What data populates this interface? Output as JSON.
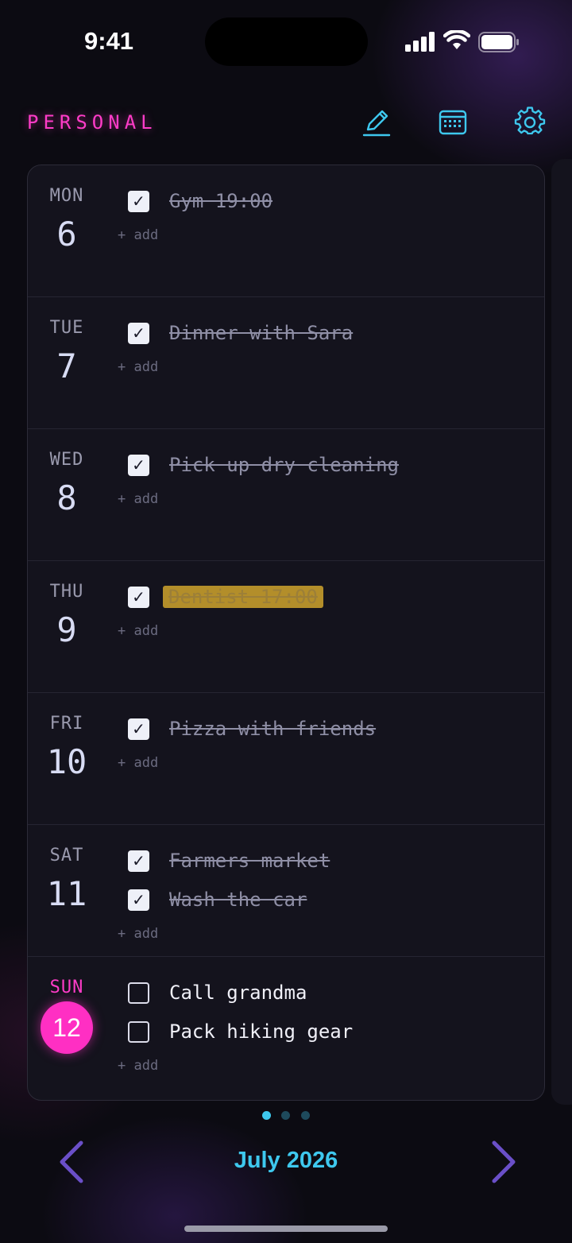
{
  "status": {
    "time": "9:41"
  },
  "header": {
    "title": "PERSONAL"
  },
  "days": [
    {
      "dow": "MON",
      "num": "6",
      "tasks": [
        {
          "label": "Gym 19:00",
          "done": true
        }
      ],
      "add_label": "+ add"
    },
    {
      "dow": "TUE",
      "num": "7",
      "tasks": [
        {
          "label": "Dinner with Sara",
          "done": true
        }
      ],
      "add_label": "+ add"
    },
    {
      "dow": "WED",
      "num": "8",
      "tasks": [
        {
          "label": "Pick up dry cleaning",
          "done": true
        }
      ],
      "add_label": "+ add"
    },
    {
      "dow": "THU",
      "num": "9",
      "tasks": [
        {
          "label": "Dentist 17:00",
          "done": true,
          "highlight": true
        }
      ],
      "add_label": "+ add"
    },
    {
      "dow": "FRI",
      "num": "10",
      "tasks": [
        {
          "label": "Pizza with friends",
          "done": true
        }
      ],
      "add_label": "+ add"
    },
    {
      "dow": "SAT",
      "num": "11",
      "tasks": [
        {
          "label": "Farmers market",
          "done": true
        },
        {
          "label": "Wash the car",
          "done": true
        }
      ],
      "add_label": "+ add"
    },
    {
      "dow": "SUN",
      "num": "12",
      "today": true,
      "tasks": [
        {
          "label": "Call grandma",
          "done": false
        },
        {
          "label": "Pack hiking gear",
          "done": false
        }
      ],
      "add_label": "+ add"
    }
  ],
  "pager": {
    "pages": 3,
    "current": 1
  },
  "footer": {
    "month": "July 2026"
  },
  "colors": {
    "accent_pink": "#ff3cc8",
    "accent_cyan": "#3ec8ee",
    "nav_purple": "#6a4fc8",
    "highlight": "#b38e2a"
  },
  "icons": {
    "edit": "pencil-icon",
    "calendar": "calendar-icon",
    "settings": "gear-icon",
    "prev": "chevron-left-icon",
    "next": "chevron-right-icon"
  }
}
